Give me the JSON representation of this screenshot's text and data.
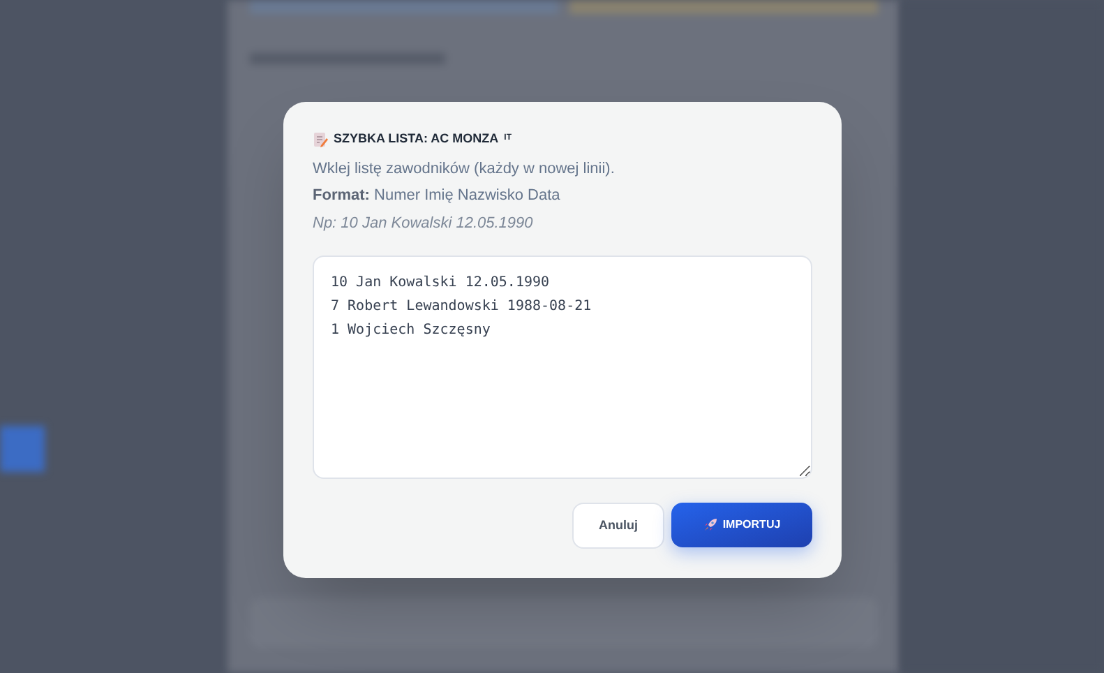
{
  "dialog": {
    "title": "SZYBKA LISTA: AC MONZA",
    "country_code": "IT",
    "instruction": "Wklej listę zawodników (każdy w nowej linii).",
    "format_label": "Format:",
    "format_value": "Numer Imię Nazwisko Data",
    "example": "Np: 10 Jan Kowalski 12.05.1990",
    "textarea_value": "10 Jan Kowalski 12.05.1990\n7 Robert Lewandowski 1988-08-21\n1 Wojciech Szczęsny",
    "buttons": [
      {
        "kind": "secondary",
        "label": "Anuluj"
      },
      {
        "kind": "primary",
        "label": "IMPORTUJ"
      }
    ]
  }
}
